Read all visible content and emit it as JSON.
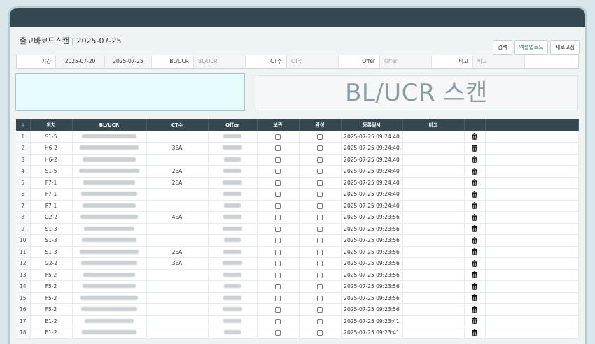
{
  "page": {
    "title": "출고바코드스캔 | 2025-07-25",
    "buttons": {
      "search": "검색",
      "excel": "엑셀업로드",
      "refresh": "새로고침"
    },
    "banner": "BL/UCR 스캔"
  },
  "filter": {
    "period_label": "기간",
    "date_from": "2025-07-20",
    "date_to": "2025-07-25",
    "bl_label": "BL/UCR",
    "bl_placeholder": "BL/UCR",
    "ct_label": "CT수",
    "ct_placeholder": "CT수",
    "offer_label": "Offer",
    "offer_placeholder": "Offer",
    "memo_label": "비고",
    "memo_placeholder": "비고"
  },
  "table": {
    "headers": [
      "#",
      "위치",
      "BL/UCR",
      "CT수",
      "Offer",
      "보관",
      "완성",
      "등록일시",
      "비고",
      ""
    ],
    "rows": [
      {
        "no": "1",
        "loc": "S1-5",
        "ct": "",
        "dt": "2025-07-25 09:24:40"
      },
      {
        "no": "2",
        "loc": "H6-2",
        "ct": "3EA",
        "dt": "2025-07-25 09:24:40"
      },
      {
        "no": "3",
        "loc": "H6-2",
        "ct": "",
        "dt": "2025-07-25 09:24:40"
      },
      {
        "no": "4",
        "loc": "S1-5",
        "ct": "2EA",
        "dt": "2025-07-25 09:24:40"
      },
      {
        "no": "5",
        "loc": "F7-1",
        "ct": "2EA",
        "dt": "2025-07-25 09:24:40"
      },
      {
        "no": "6",
        "loc": "F7-1",
        "ct": "",
        "dt": "2025-07-25 09:24:40"
      },
      {
        "no": "7",
        "loc": "F7-1",
        "ct": "",
        "dt": "2025-07-25 09:24:40"
      },
      {
        "no": "8",
        "loc": "G2-2",
        "ct": "4EA",
        "dt": "2025-07-25 09:23:56"
      },
      {
        "no": "9",
        "loc": "S1-3",
        "ct": "",
        "dt": "2025-07-25 09:23:56"
      },
      {
        "no": "10",
        "loc": "S1-3",
        "ct": "",
        "dt": "2025-07-25 09:23:56"
      },
      {
        "no": "11",
        "loc": "S1-3",
        "ct": "2EA",
        "dt": "2025-07-25 09:23:56"
      },
      {
        "no": "12",
        "loc": "G2-2",
        "ct": "3EA",
        "dt": "2025-07-25 09:23:56"
      },
      {
        "no": "13",
        "loc": "F5-2",
        "ct": "",
        "dt": "2025-07-25 09:23:56"
      },
      {
        "no": "14",
        "loc": "F5-2",
        "ct": "",
        "dt": "2025-07-25 09:23:56"
      },
      {
        "no": "15",
        "loc": "F5-2",
        "ct": "",
        "dt": "2025-07-25 09:23:56"
      },
      {
        "no": "16",
        "loc": "F5-2",
        "ct": "",
        "dt": "2025-07-25 09:23:56"
      },
      {
        "no": "17",
        "loc": "E1-2",
        "ct": "",
        "dt": "2025-07-25 09:23:41"
      },
      {
        "no": "18",
        "loc": "E1-2",
        "ct": "",
        "dt": "2025-07-25 09:23:41"
      }
    ]
  }
}
